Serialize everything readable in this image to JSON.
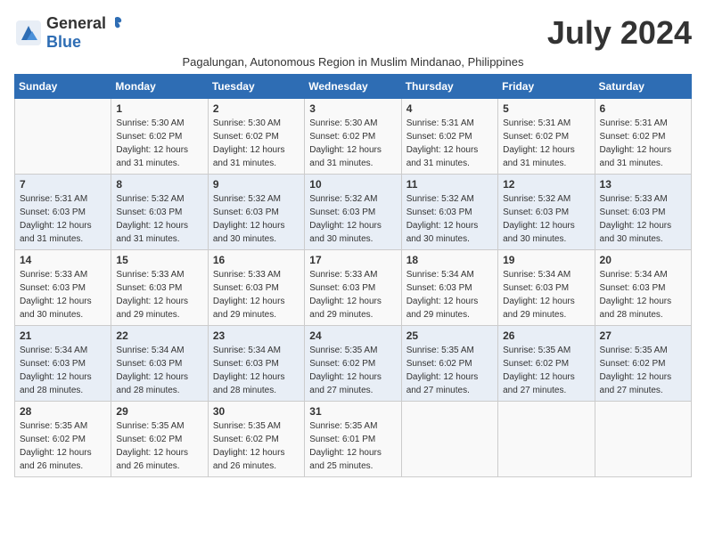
{
  "logo": {
    "general": "General",
    "blue": "Blue"
  },
  "title": "July 2024",
  "subtitle": "Pagalungan, Autonomous Region in Muslim Mindanao, Philippines",
  "header_days": [
    "Sunday",
    "Monday",
    "Tuesday",
    "Wednesday",
    "Thursday",
    "Friday",
    "Saturday"
  ],
  "weeks": [
    [
      {
        "day": "",
        "info": ""
      },
      {
        "day": "1",
        "info": "Sunrise: 5:30 AM\nSunset: 6:02 PM\nDaylight: 12 hours\nand 31 minutes."
      },
      {
        "day": "2",
        "info": "Sunrise: 5:30 AM\nSunset: 6:02 PM\nDaylight: 12 hours\nand 31 minutes."
      },
      {
        "day": "3",
        "info": "Sunrise: 5:30 AM\nSunset: 6:02 PM\nDaylight: 12 hours\nand 31 minutes."
      },
      {
        "day": "4",
        "info": "Sunrise: 5:31 AM\nSunset: 6:02 PM\nDaylight: 12 hours\nand 31 minutes."
      },
      {
        "day": "5",
        "info": "Sunrise: 5:31 AM\nSunset: 6:02 PM\nDaylight: 12 hours\nand 31 minutes."
      },
      {
        "day": "6",
        "info": "Sunrise: 5:31 AM\nSunset: 6:02 PM\nDaylight: 12 hours\nand 31 minutes."
      }
    ],
    [
      {
        "day": "7",
        "info": "Sunrise: 5:31 AM\nSunset: 6:03 PM\nDaylight: 12 hours\nand 31 minutes."
      },
      {
        "day": "8",
        "info": "Sunrise: 5:32 AM\nSunset: 6:03 PM\nDaylight: 12 hours\nand 31 minutes."
      },
      {
        "day": "9",
        "info": "Sunrise: 5:32 AM\nSunset: 6:03 PM\nDaylight: 12 hours\nand 30 minutes."
      },
      {
        "day": "10",
        "info": "Sunrise: 5:32 AM\nSunset: 6:03 PM\nDaylight: 12 hours\nand 30 minutes."
      },
      {
        "day": "11",
        "info": "Sunrise: 5:32 AM\nSunset: 6:03 PM\nDaylight: 12 hours\nand 30 minutes."
      },
      {
        "day": "12",
        "info": "Sunrise: 5:32 AM\nSunset: 6:03 PM\nDaylight: 12 hours\nand 30 minutes."
      },
      {
        "day": "13",
        "info": "Sunrise: 5:33 AM\nSunset: 6:03 PM\nDaylight: 12 hours\nand 30 minutes."
      }
    ],
    [
      {
        "day": "14",
        "info": "Sunrise: 5:33 AM\nSunset: 6:03 PM\nDaylight: 12 hours\nand 30 minutes."
      },
      {
        "day": "15",
        "info": "Sunrise: 5:33 AM\nSunset: 6:03 PM\nDaylight: 12 hours\nand 29 minutes."
      },
      {
        "day": "16",
        "info": "Sunrise: 5:33 AM\nSunset: 6:03 PM\nDaylight: 12 hours\nand 29 minutes."
      },
      {
        "day": "17",
        "info": "Sunrise: 5:33 AM\nSunset: 6:03 PM\nDaylight: 12 hours\nand 29 minutes."
      },
      {
        "day": "18",
        "info": "Sunrise: 5:34 AM\nSunset: 6:03 PM\nDaylight: 12 hours\nand 29 minutes."
      },
      {
        "day": "19",
        "info": "Sunrise: 5:34 AM\nSunset: 6:03 PM\nDaylight: 12 hours\nand 29 minutes."
      },
      {
        "day": "20",
        "info": "Sunrise: 5:34 AM\nSunset: 6:03 PM\nDaylight: 12 hours\nand 28 minutes."
      }
    ],
    [
      {
        "day": "21",
        "info": "Sunrise: 5:34 AM\nSunset: 6:03 PM\nDaylight: 12 hours\nand 28 minutes."
      },
      {
        "day": "22",
        "info": "Sunrise: 5:34 AM\nSunset: 6:03 PM\nDaylight: 12 hours\nand 28 minutes."
      },
      {
        "day": "23",
        "info": "Sunrise: 5:34 AM\nSunset: 6:03 PM\nDaylight: 12 hours\nand 28 minutes."
      },
      {
        "day": "24",
        "info": "Sunrise: 5:35 AM\nSunset: 6:02 PM\nDaylight: 12 hours\nand 27 minutes."
      },
      {
        "day": "25",
        "info": "Sunrise: 5:35 AM\nSunset: 6:02 PM\nDaylight: 12 hours\nand 27 minutes."
      },
      {
        "day": "26",
        "info": "Sunrise: 5:35 AM\nSunset: 6:02 PM\nDaylight: 12 hours\nand 27 minutes."
      },
      {
        "day": "27",
        "info": "Sunrise: 5:35 AM\nSunset: 6:02 PM\nDaylight: 12 hours\nand 27 minutes."
      }
    ],
    [
      {
        "day": "28",
        "info": "Sunrise: 5:35 AM\nSunset: 6:02 PM\nDaylight: 12 hours\nand 26 minutes."
      },
      {
        "day": "29",
        "info": "Sunrise: 5:35 AM\nSunset: 6:02 PM\nDaylight: 12 hours\nand 26 minutes."
      },
      {
        "day": "30",
        "info": "Sunrise: 5:35 AM\nSunset: 6:02 PM\nDaylight: 12 hours\nand 26 minutes."
      },
      {
        "day": "31",
        "info": "Sunrise: 5:35 AM\nSunset: 6:01 PM\nDaylight: 12 hours\nand 25 minutes."
      },
      {
        "day": "",
        "info": ""
      },
      {
        "day": "",
        "info": ""
      },
      {
        "day": "",
        "info": ""
      }
    ]
  ]
}
